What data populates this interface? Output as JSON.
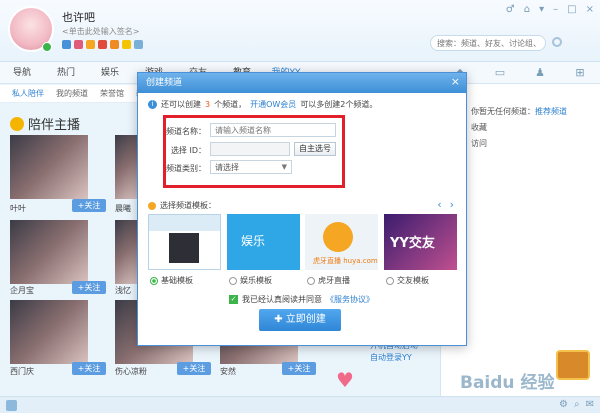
{
  "header": {
    "username": "也许吧",
    "signature": "<单击此处输入签名>",
    "search_placeholder": "搜索：频道、好友、讨论组、群",
    "window_controls": [
      "♂",
      "⌂",
      "▾",
      "–",
      "□",
      "×"
    ]
  },
  "nav": {
    "items": [
      "导航",
      "热门",
      "娱乐",
      "游戏",
      "交友",
      "教育",
      "我的YY"
    ],
    "active_index": 6,
    "subnav": [
      "私人陪伴",
      "我的频道",
      "荣誉馆",
      "新"
    ]
  },
  "right_panel": {
    "tab_icons": [
      "◆",
      "▭",
      "♟",
      "⊞"
    ],
    "line1_prefix": "还",
    "line1_text": "你暂无任何频道：",
    "line1_link": "推荐频道",
    "line2": "收藏",
    "line3": "访问",
    "promo": "开机自动启动\n自动登录YY"
  },
  "main": {
    "section_title": "陪伴主播",
    "anchors": [
      {
        "name": "叶叶",
        "follow": "+关注"
      },
      {
        "name": "晨曦",
        "follow": "+关注"
      },
      {
        "name": "企月宝",
        "follow": "+关注"
      },
      {
        "name": "浅忆",
        "follow": "+关注"
      },
      {
        "name": "西门庆",
        "follow": "+关注"
      },
      {
        "name": "伤心凉粉",
        "follow": "+关注"
      },
      {
        "name": "安然",
        "follow": "+关注"
      }
    ]
  },
  "modal": {
    "title": "创建频道",
    "close": "×",
    "info_prefix": "还可以创建",
    "info_count": "3",
    "info_mid": "个频道，",
    "info_link": "开通OW会员",
    "info_suffix": "可以多创建2个频道。",
    "form": {
      "name_label": "频道名称：",
      "name_placeholder": "请输入频道名称",
      "id_label": "选择 ID：",
      "id_value": "",
      "auto_button": "自主选号",
      "type_label": "频道类别：",
      "type_value": "请选择"
    },
    "template_title": "选择频道模板：",
    "template_nav": [
      "‹",
      "›"
    ],
    "templates": [
      {
        "label": "基础模板",
        "selected": true
      },
      {
        "label": "娱乐模板",
        "selected": false
      },
      {
        "label": "虎牙直播",
        "selected": false
      },
      {
        "label": "交友模板",
        "selected": false
      }
    ],
    "template_art": [
      "",
      "娱乐",
      "虎牙直播 huya.com",
      "YY交友"
    ],
    "agree_prefix": "我已经认真阅读并同意",
    "agree_link": "《服务协议》",
    "create_button": "立即创建"
  },
  "watermark": "Baidu 经验"
}
